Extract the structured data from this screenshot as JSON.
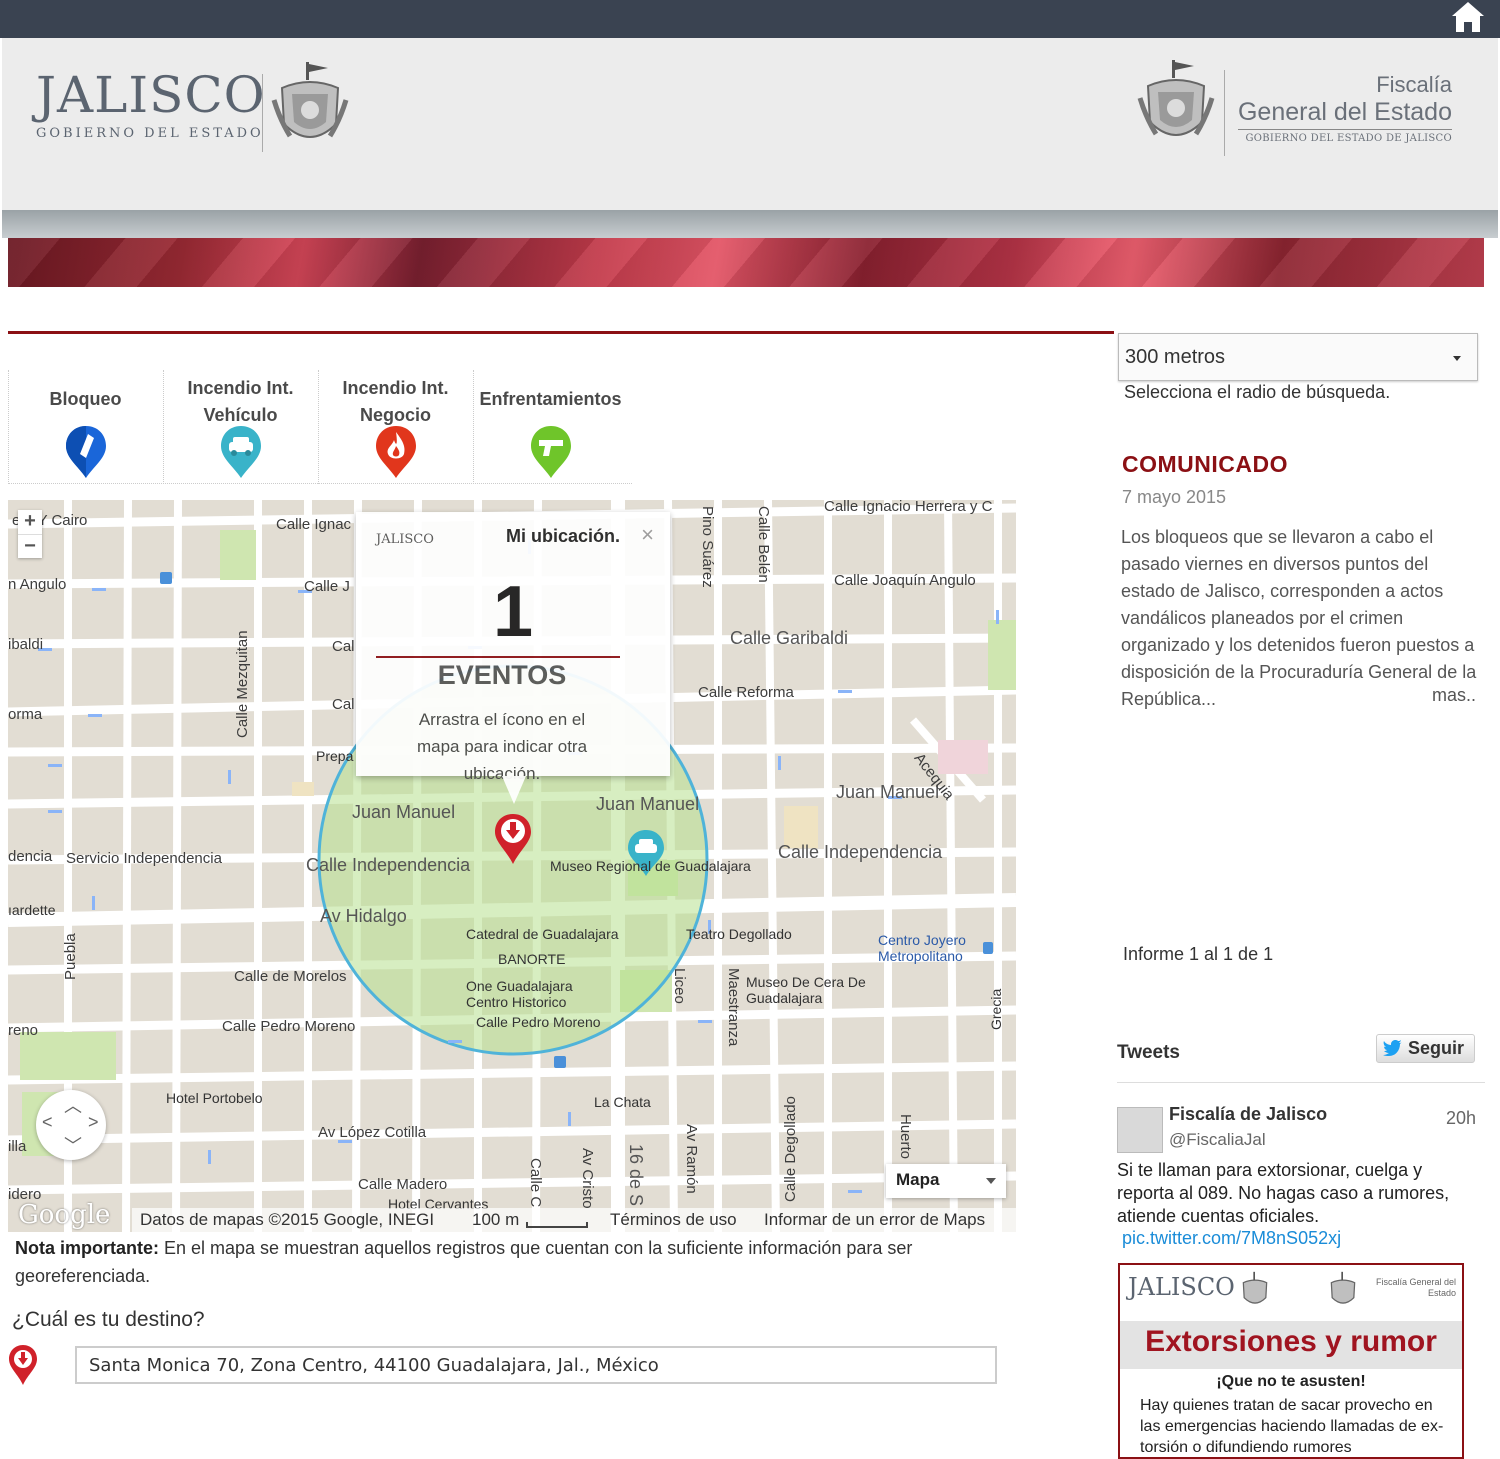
{
  "header": {
    "jalisco_title": "JALISCO",
    "jalisco_subtitle": "GOBIERNO DEL ESTADO",
    "fiscalia_line1": "Fiscalía",
    "fiscalia_line2": "General del Estado",
    "fiscalia_line3": "GOBIERNO DEL ESTADO DE JALISCO"
  },
  "categories": [
    {
      "label": "Bloqueo",
      "icon": "blue-bloqueo-pin-icon",
      "color": "#1a66d9"
    },
    {
      "label": "Incendio Int. Vehículo",
      "icon": "teal-car-pin-icon",
      "color": "#39b3c9"
    },
    {
      "label": "Incendio Int. Negocio",
      "icon": "red-fire-pin-icon",
      "color": "#e1361c"
    },
    {
      "label": "Enfrentamientos",
      "icon": "green-gun-pin-icon",
      "color": "#6fc52a"
    }
  ],
  "map": {
    "infowindow": {
      "title": "Mi ubicación.",
      "close": "×",
      "mini_logo": "JALISCO",
      "count": "1",
      "events_label": "EVENTOS",
      "message": "Arrastra el ícono en el mapa para indicar otra ubicación."
    },
    "labels": {
      "l1": "Calle Ignacio Herrera y C",
      "l2": "Calle Joaquín Angulo",
      "l3": "Calle Garibaldi",
      "l4": "Calle Reforma",
      "l5": "Juan Manuel",
      "l6": "Juan Manuel",
      "l7": "Juan Manuel",
      "l8": "Calle Independencia",
      "l9": "Calle Independencia",
      "l10": "Av Hidalgo",
      "l11": "Museo Regional de Guadalajara",
      "l12": "Catedral de Guadalajara",
      "l13": "BANORTE",
      "l14": "One Guadalajara Centro Historico",
      "l15": "Calle Pedro Moreno",
      "l16": "Teatro Degollado",
      "l17": "Centro Joyero Metropolitano",
      "l18": "Museo De Cera De Guadalajara",
      "l19": "Calle de Morelos",
      "l20": "Calle Pedro Moreno",
      "l21": "Hotel Portobelo",
      "l22": "Av López Cotilla",
      "l23": "La Chata",
      "l24": "Calle Madero",
      "l25": "Servicio Independencia",
      "l26": "Calle Mezquitan",
      "l27": "Pino Suárez",
      "l28": "Calle Belén",
      "l29": "Acequia",
      "l30": "Maestranza",
      "l31": "Liceo",
      "l32": "Calle Degollado",
      "l33": "Puebla",
      "l34": "Prepa",
      "l35": "era Y Cairo",
      "l36": "n Angulo",
      "l37": "ibaldi",
      "l38": "orma",
      "l39": "dencia",
      "l40": "ıardette",
      "l41": "reno",
      "l42": "illa",
      "l43": "idero",
      "l44": "Grecia",
      "l45": "Huerto",
      "l46": "Av Ramón",
      "l47": "16 de S",
      "l48": "Av Cristo",
      "l49": "Calle Ignac",
      "l50": "Calle J",
      "l51": "Cal",
      "l52": "Cal",
      "l53": "Hotel Cervantes",
      "l54": "Calle C"
    },
    "maptype": "Mapa",
    "footer": {
      "google": "Google",
      "data": "Datos de mapas ©2015 Google, INEGI",
      "scale": "100 m",
      "terms": "Términos de uso",
      "report": "Informar de un error de Maps"
    },
    "zoom_in": "+",
    "zoom_out": "−"
  },
  "note": {
    "bold": "Nota importante:",
    "text": " En el mapa se muestran aquellos registros que cuentan con la suficiente información para ser georeferenciada."
  },
  "destination": {
    "question": "¿Cuál es tu destino?",
    "value": "Santa Monica 70, Zona Centro, 44100 Guadalajara, Jal., México"
  },
  "sidebar": {
    "radius_value": "300 metros",
    "radius_help": "Selecciona el radio de búsqueda.",
    "comunicado_title": "COMUNICADO",
    "comunicado_date": "7 mayo 2015",
    "comunicado_text": "Los bloqueos que se llevaron a cabo el pasado viernes en diversos puntos del estado de Jalisco, corresponden a actos vandálicos planeados por el crimen organizado y los detenidos fueron puestos a disposición de la Procuraduría General de la República...",
    "comunicado_more": "mas..",
    "informe": "Informe 1 al 1 de 1"
  },
  "tweets": {
    "heading": "Tweets",
    "follow": "Seguir",
    "name": "Fiscalía de Jalisco",
    "handle": "@FiscaliaJal",
    "time": "20h",
    "text": "Si te llaman para extorsionar, cuelga y reporta al 089. No hagas caso a rumores, atiende cuentas oficiales.",
    "link": "pic.twitter.com/7M8nS052xj",
    "image": {
      "jal": "JALISCO",
      "fis": "Fiscalía General del Estado",
      "title": "Extorsiones y rumor",
      "subtitle": "¡Que no te asusten!",
      "body": "Hay quienes tratan de sacar provecho en las emergencias haciendo llamadas de ex-torsión o difundiendo rumores"
    }
  },
  "colors": {
    "topbar": "#3a4351",
    "accent_red": "#8b1014",
    "circle": "#4fb3d9",
    "twitter_link": "#1a8cd8"
  }
}
